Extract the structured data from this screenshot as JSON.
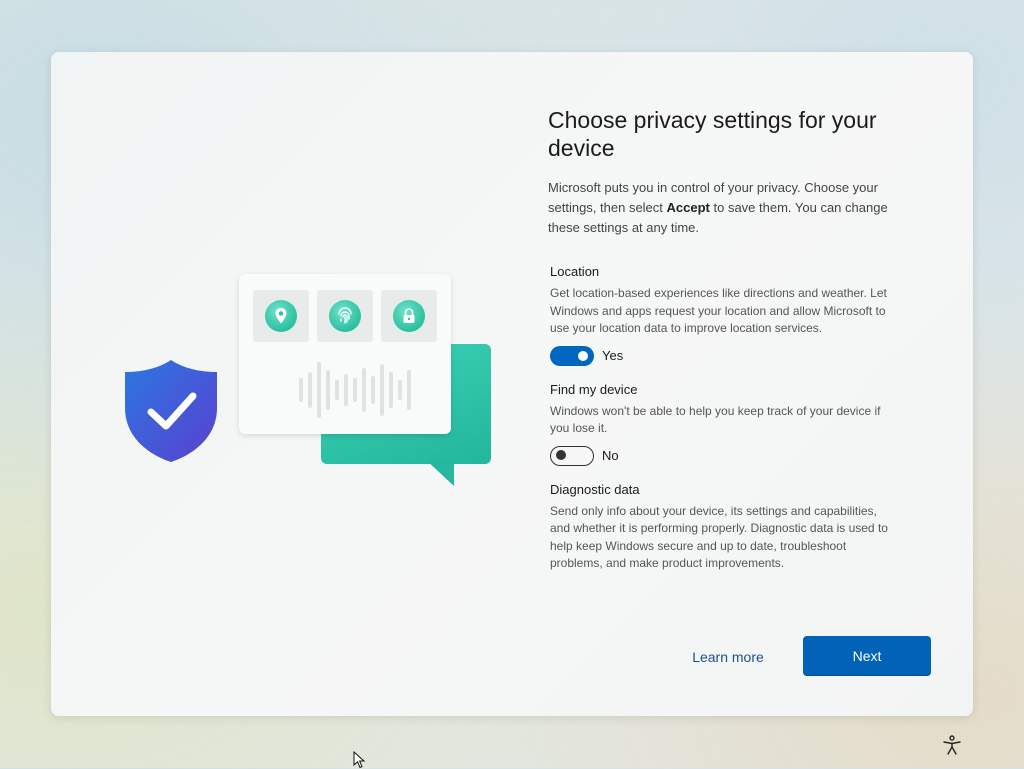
{
  "page": {
    "title": "Choose privacy settings for your device",
    "intro_before": "Microsoft puts you in control of your privacy. Choose your settings, then select ",
    "intro_bold": "Accept",
    "intro_after": " to save them. You can change these settings at any time."
  },
  "settings": [
    {
      "title": "Location",
      "description": "Get location-based experiences like directions and weather. Let Windows and apps request your location and allow Microsoft to use your location data to improve location services.",
      "state": "Yes"
    },
    {
      "title": "Find my device",
      "description": "Windows won't be able to help you keep track of your device if you lose it.",
      "state": "No"
    },
    {
      "title": "Diagnostic data",
      "description": "Send only info about your device, its settings and capabilities, and whether it is performing properly. Diagnostic data is used to help keep Windows secure and up to date, troubleshoot problems, and make product improvements."
    }
  ],
  "footer": {
    "learn_more": "Learn more",
    "next": "Next"
  },
  "colors": {
    "accent": "#0067c0",
    "next_button": "#0063b8",
    "teal": "#2cbf9f",
    "shield": "#4552d4"
  },
  "icons": [
    "location-pin-icon",
    "fingerprint-icon",
    "lock-icon",
    "shield-check-icon",
    "accessibility-icon",
    "mouse-cursor-icon"
  ]
}
